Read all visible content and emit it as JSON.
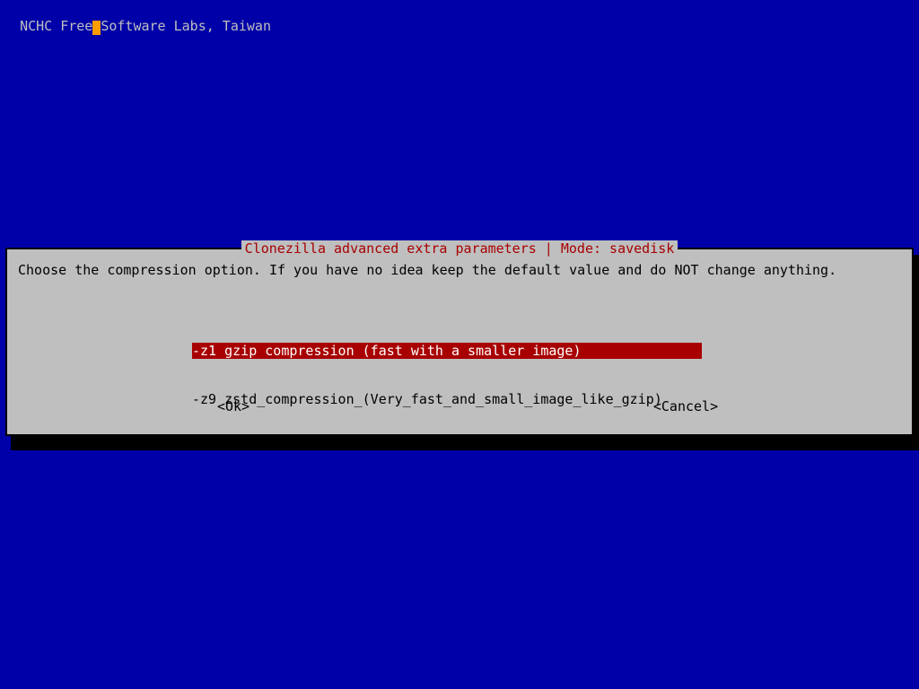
{
  "header": {
    "left": "NCHC Free",
    "right": "Software Labs, Taiwan"
  },
  "dialog": {
    "title": "Clonezilla advanced extra parameters | Mode: savedisk",
    "prompt": "Choose the compression option. If you have no idea keep the default value and do NOT change anything.",
    "options": [
      {
        "flag": "-z1",
        "desc": "gzip compression (fast with a smaller image)",
        "selected": true
      },
      {
        "flag": "-z9",
        "desc": "zstd_compression_(Very_fast_and_small_image_like_gzip)",
        "selected": false
      }
    ],
    "ok_label": "<Ok>",
    "cancel_label": "<Cancel>"
  },
  "colors": {
    "bg": "#0000a8",
    "panel": "#bfbfbf",
    "title": "#a80000",
    "highlight_bg": "#a80000",
    "highlight_fg": "#ffffff",
    "cursor": "#ff9c00"
  }
}
